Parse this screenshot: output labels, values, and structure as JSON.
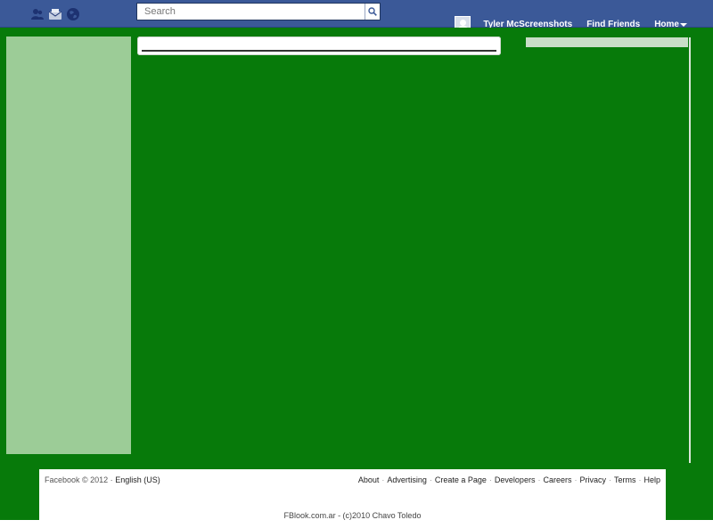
{
  "topbar": {
    "jewels": [
      {
        "icon": "friend-requests-icon"
      },
      {
        "icon": "messages-icon"
      },
      {
        "icon": "notifications-globe-icon"
      }
    ],
    "search": {
      "placeholder": "Search"
    },
    "user_name": "Tyler McScreenshots",
    "find_friends": "Find Friends",
    "home": "Home"
  },
  "colors": {
    "topbar": "#3b5998",
    "content_bg": "#077a0a",
    "left_column": "#9ccc97"
  },
  "footer": {
    "copyright": "Facebook © 2012 ·",
    "language": "English (US)",
    "links": [
      "About",
      "Advertising",
      "Create a Page",
      "Developers",
      "Careers",
      "Privacy",
      "Terms",
      "Help"
    ],
    "credit": "FBlook.com.ar - (c)2010 Chavo Toledo"
  }
}
